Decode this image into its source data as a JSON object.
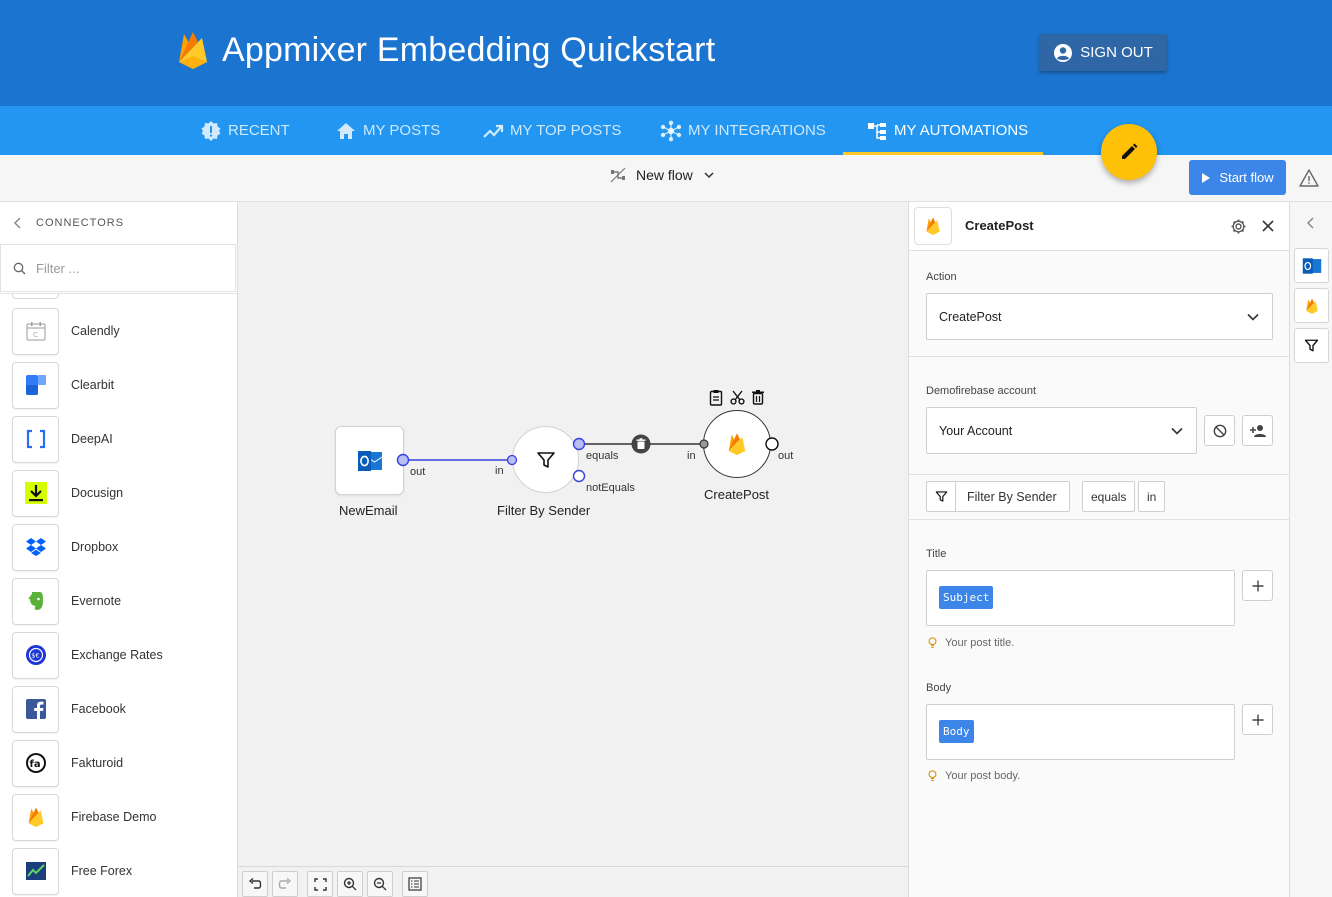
{
  "header": {
    "title": "Appmixer Embedding Quickstart",
    "signout_label": "SIGN OUT"
  },
  "tabs": [
    {
      "label": "RECENT",
      "icon": "alert-badge-icon",
      "active": false
    },
    {
      "label": "MY POSTS",
      "icon": "home-icon",
      "active": false
    },
    {
      "label": "MY TOP POSTS",
      "icon": "trending-up-icon",
      "active": false
    },
    {
      "label": "MY INTEGRATIONS",
      "icon": "hub-icon",
      "active": false
    },
    {
      "label": "MY AUTOMATIONS",
      "icon": "flow-tree-icon",
      "active": true
    }
  ],
  "toolbar": {
    "flow_name": "New flow",
    "start_label": "Start flow"
  },
  "connectors": {
    "header": "CONNECTORS",
    "filter_placeholder": "Filter ...",
    "items": [
      {
        "name": "Calendly",
        "icon": "calendly-icon"
      },
      {
        "name": "Clearbit",
        "icon": "clearbit-icon"
      },
      {
        "name": "DeepAI",
        "icon": "deepai-icon"
      },
      {
        "name": "Docusign",
        "icon": "docusign-icon"
      },
      {
        "name": "Dropbox",
        "icon": "dropbox-icon"
      },
      {
        "name": "Evernote",
        "icon": "evernote-icon"
      },
      {
        "name": "Exchange Rates",
        "icon": "exchange-rates-icon"
      },
      {
        "name": "Facebook",
        "icon": "facebook-icon"
      },
      {
        "name": "Fakturoid",
        "icon": "fakturoid-icon"
      },
      {
        "name": "Firebase Demo",
        "icon": "firebase-icon"
      },
      {
        "name": "Free Forex",
        "icon": "free-forex-icon"
      }
    ]
  },
  "flow": {
    "nodes": [
      {
        "label": "NewEmail",
        "icon": "outlook-icon"
      },
      {
        "label": "Filter By Sender",
        "icon": "filter-icon"
      },
      {
        "label": "CreatePost",
        "icon": "firebase-icon"
      }
    ],
    "ports": {
      "out": "out",
      "in": "in",
      "equals": "equals",
      "not_equals": "notEquals"
    }
  },
  "inspector": {
    "title": "CreatePost",
    "action_label": "Action",
    "action_value": "CreatePost",
    "account_label": "Demofirebase account",
    "account_value": "Your Account",
    "source_chip": "Filter By Sender",
    "source_port_chip": "equals",
    "target_port_chip": "in",
    "title_field_label": "Title",
    "title_tag": "Subject",
    "title_hint": "Your post title.",
    "body_field_label": "Body",
    "body_tag": "Body",
    "body_hint": "Your post body."
  },
  "colors": {
    "header": "#1b74cf",
    "tabs": "#2296f0",
    "accent": "#ffc107",
    "primary_button": "#3b86e8"
  }
}
